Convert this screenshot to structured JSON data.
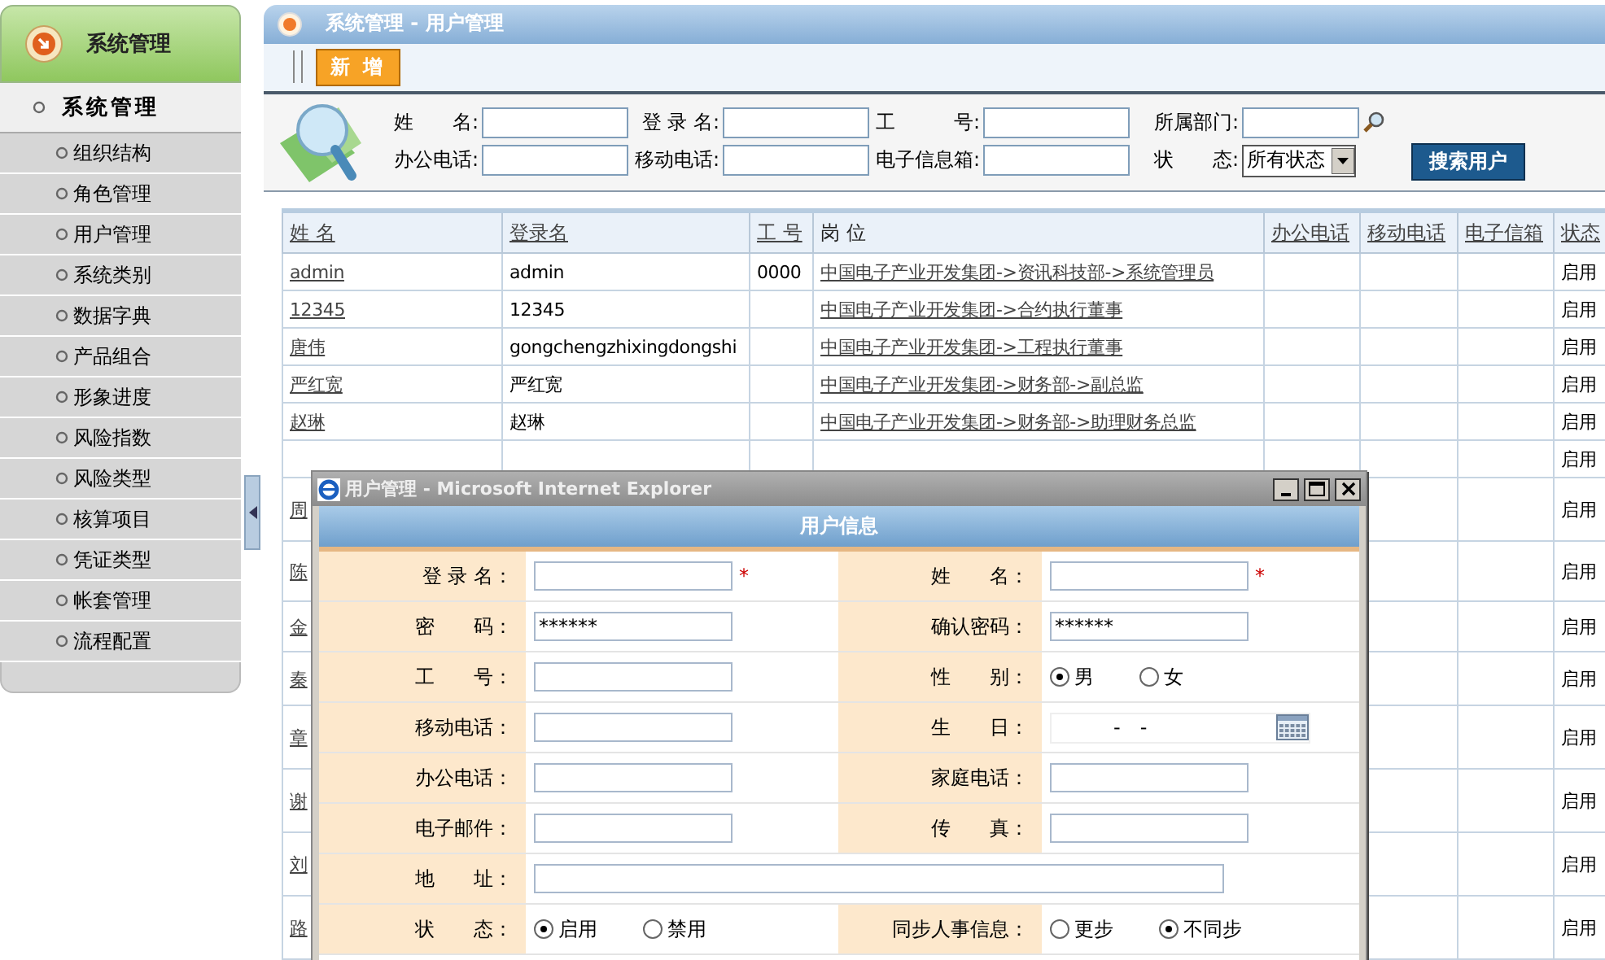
{
  "sidebar": {
    "header": "系统管理",
    "section": "系统管理",
    "items": [
      {
        "label": "组织结构"
      },
      {
        "label": "角色管理"
      },
      {
        "label": "用户管理"
      },
      {
        "label": "系统类别"
      },
      {
        "label": "数据字典"
      },
      {
        "label": "产品组合"
      },
      {
        "label": "形象进度"
      },
      {
        "label": "风险指数"
      },
      {
        "label": "风险类型"
      },
      {
        "label": "核算项目"
      },
      {
        "label": "凭证类型"
      },
      {
        "label": "帐套管理"
      },
      {
        "label": "流程配置"
      }
    ]
  },
  "page_title": "系统管理 - 用户管理",
  "toolbar": {
    "add_button": "新 增"
  },
  "search": {
    "fields": [
      {
        "label": "姓　　名:",
        "kind": "text"
      },
      {
        "label": "登 录 名:",
        "kind": "text"
      },
      {
        "label": "工　　　号:",
        "kind": "text"
      },
      {
        "label": "所属部门:",
        "kind": "lookup"
      },
      {
        "label": "办公电话:",
        "kind": "text"
      },
      {
        "label": "移动电话:",
        "kind": "text"
      },
      {
        "label": "电子信息箱:",
        "kind": "text"
      },
      {
        "label": "状　　态:",
        "kind": "select",
        "value": "所有状态"
      }
    ],
    "button": "搜索用户"
  },
  "table": {
    "columns": [
      "姓 名",
      "登录名",
      "工 号",
      "岗 位",
      "办公电话",
      "移动电话",
      "电子信箱",
      "状态"
    ],
    "rows": [
      {
        "name": "admin",
        "login": "admin",
        "id": "0000",
        "position": "中国电子产业开发集团->资讯科技部->系统管理员",
        "status": "启用"
      },
      {
        "name": "12345",
        "login": "12345",
        "position": "中国电子产业开发集团->合约执行董事",
        "status": "启用"
      },
      {
        "name": "唐伟",
        "login": "gongchengzhixingdongshi",
        "position": "中国电子产业开发集团->工程执行董事",
        "status": "启用"
      },
      {
        "name": "严红宽",
        "login": "严红宽",
        "position": "中国电子产业开发集团->财务部->副总监",
        "status": "启用"
      },
      {
        "name": "赵琳",
        "login": "赵琳",
        "position": "中国电子产业开发集团->财务部->助理财务总监",
        "status": "启用"
      },
      {
        "status": "启用"
      },
      {
        "name": "周",
        "status": "启用"
      },
      {
        "name": "陈",
        "status": "启用"
      },
      {
        "name": "金",
        "status": "启用"
      },
      {
        "name": "秦",
        "status": "启用"
      },
      {
        "name": "章",
        "status": "启用"
      },
      {
        "name": "谢",
        "status": "启用"
      },
      {
        "name": "刘",
        "status": "启用"
      },
      {
        "name": "路",
        "status": "启用"
      }
    ]
  },
  "dialog": {
    "title": "用户管理 - Microsoft Internet Explorer",
    "heading": "用户信息",
    "rows": [
      {
        "fields": [
          {
            "label": "登 录 名：",
            "kind": "text",
            "mark": "*"
          },
          {
            "label": "姓　　名：",
            "kind": "text",
            "mark": "*"
          }
        ]
      },
      {
        "fields": [
          {
            "label": "密　　码：",
            "kind": "text",
            "value": "******"
          },
          {
            "label": "确认密码：",
            "kind": "text",
            "value": "******"
          }
        ]
      },
      {
        "fields": [
          {
            "label": "工　　号：",
            "kind": "text"
          },
          {
            "label": "性　　别：",
            "kind": "radio",
            "options": [
              {
                "label": "男",
                "selected": true
              },
              {
                "label": "女",
                "selected": false
              }
            ]
          }
        ]
      },
      {
        "fields": [
          {
            "label": "移动电话：",
            "kind": "text"
          },
          {
            "label": "生　　日：",
            "kind": "date",
            "value": "-　-"
          }
        ]
      },
      {
        "fields": [
          {
            "label": "办公电话：",
            "kind": "text"
          },
          {
            "label": "家庭电话：",
            "kind": "text"
          }
        ]
      },
      {
        "fields": [
          {
            "label": "电子邮件：",
            "kind": "text"
          },
          {
            "label": "传　　真：",
            "kind": "text"
          }
        ]
      },
      {
        "fields": [
          {
            "label": "地　　址：",
            "kind": "wide"
          }
        ]
      },
      {
        "fields": [
          {
            "label": "状　　态：",
            "kind": "radio",
            "options": [
              {
                "label": "启用",
                "selected": true
              },
              {
                "label": "禁用",
                "selected": false
              }
            ]
          },
          {
            "label": "同步人事信息：",
            "kind": "radio",
            "options": [
              {
                "label": "更步",
                "selected": false
              },
              {
                "label": "不同步",
                "selected": true
              }
            ]
          }
        ]
      }
    ]
  }
}
